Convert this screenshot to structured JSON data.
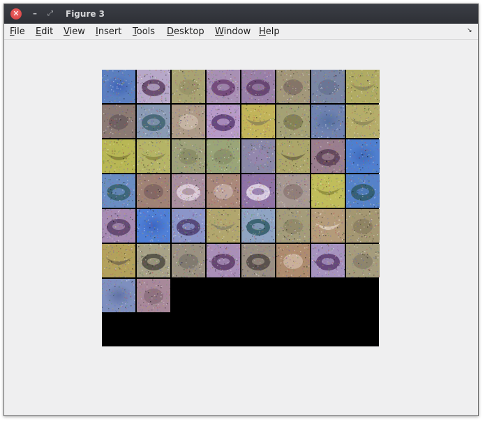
{
  "window": {
    "title": "Figure 3",
    "close_glyph": "✕",
    "minimize_glyph": "–",
    "restore_glyph": "⤢"
  },
  "menu": {
    "items": [
      {
        "label": "File",
        "mnemonic": "F"
      },
      {
        "label": "Edit",
        "mnemonic": "E"
      },
      {
        "label": "View",
        "mnemonic": "V"
      },
      {
        "label": "Insert",
        "mnemonic": "I"
      },
      {
        "label": "Tools",
        "mnemonic": "T"
      },
      {
        "label": "Desktop",
        "mnemonic": "D"
      },
      {
        "label": "Window",
        "mnemonic": "W"
      },
      {
        "label": "Help",
        "mnemonic": "H"
      }
    ],
    "dock_icon": "dock-arrow-icon",
    "dock_glyph": "↘"
  },
  "figure": {
    "grid_rows": 8,
    "grid_cols": 8,
    "filled_tiles": 50,
    "background_color": "#000000",
    "tiles": [
      {
        "bg": "#5b7fc0",
        "fg": "#3e63b8",
        "kind": "blob"
      },
      {
        "bg": "#b7a8c9",
        "fg": "#5d3e63",
        "kind": "ring"
      },
      {
        "bg": "#a8a373",
        "fg": "#8f8a63",
        "kind": "noise"
      },
      {
        "bg": "#a890b4",
        "fg": "#6c3f73",
        "kind": "ring"
      },
      {
        "bg": "#9a80a8",
        "fg": "#5f3c6a",
        "kind": "ring"
      },
      {
        "bg": "#a2977a",
        "fg": "#6b5a5a",
        "kind": "noise"
      },
      {
        "bg": "#7a86a4",
        "fg": "#5d6a8a",
        "kind": "noise"
      },
      {
        "bg": "#b0ab63",
        "fg": "#8c8a58",
        "kind": "smile"
      },
      {
        "bg": "#8b7a74",
        "fg": "#5a4b52",
        "kind": "noise"
      },
      {
        "bg": "#8a9ab5",
        "fg": "#3d6170",
        "kind": "ring"
      },
      {
        "bg": "#ae9b88",
        "fg": "#d8c9b9",
        "kind": "noise"
      },
      {
        "bg": "#b79ac8",
        "fg": "#5b3b73",
        "kind": "ring"
      },
      {
        "bg": "#c2b45a",
        "fg": "#8b8255",
        "kind": "smile"
      },
      {
        "bg": "#a4a175",
        "fg": "#6b6a3d",
        "kind": "noise"
      },
      {
        "bg": "#6f82b0",
        "fg": "#5470a2",
        "kind": "blob"
      },
      {
        "bg": "#b5ad6a",
        "fg": "#8e8659",
        "kind": "smile"
      },
      {
        "bg": "#b8b755",
        "fg": "#817e36",
        "kind": "smile"
      },
      {
        "bg": "#b5b466",
        "fg": "#8a8840",
        "kind": "smile"
      },
      {
        "bg": "#9ea07a",
        "fg": "#7c7f59",
        "kind": "noise"
      },
      {
        "bg": "#9aa578",
        "fg": "#7f8562",
        "kind": "noise"
      },
      {
        "bg": "#8a88a8",
        "fg": "#9a86b0",
        "kind": "noise"
      },
      {
        "bg": "#aca66a",
        "fg": "#6e6740",
        "kind": "smile"
      },
      {
        "bg": "#9a7e8e",
        "fg": "#5a3e55",
        "kind": "ring"
      },
      {
        "bg": "#4f7fcf",
        "fg": "#3e6bbd",
        "kind": "blob"
      },
      {
        "bg": "#6a8dc3",
        "fg": "#35606c",
        "kind": "ring"
      },
      {
        "bg": "#9f8276",
        "fg": "#6b5356",
        "kind": "noise"
      },
      {
        "bg": "#a88f9f",
        "fg": "#e2d4df",
        "kind": "ring"
      },
      {
        "bg": "#a9887a",
        "fg": "#d6c3c0",
        "kind": "noise"
      },
      {
        "bg": "#8f73a6",
        "fg": "#e5dcea",
        "kind": "ring"
      },
      {
        "bg": "#a79893",
        "fg": "#7d6a66",
        "kind": "noise"
      },
      {
        "bg": "#c0bd5b",
        "fg": "#8a8838",
        "kind": "smile"
      },
      {
        "bg": "#5582c9",
        "fg": "#2f5a68",
        "kind": "ring"
      },
      {
        "bg": "#a68bb3",
        "fg": "#5a3f68",
        "kind": "ring"
      },
      {
        "bg": "#4f7fd6",
        "fg": "#3b66c4",
        "kind": "blob"
      },
      {
        "bg": "#8b95c9",
        "fg": "#4b3c6e",
        "kind": "ring"
      },
      {
        "bg": "#b1a66e",
        "fg": "#8a8466",
        "kind": "smile"
      },
      {
        "bg": "#8fa4c3",
        "fg": "#2f5a66",
        "kind": "ring"
      },
      {
        "bg": "#a49c7a",
        "fg": "#857d5e",
        "kind": "noise"
      },
      {
        "bg": "#b49b7a",
        "fg": "#e0d1bd",
        "kind": "smile"
      },
      {
        "bg": "#a49772",
        "fg": "#7e7358",
        "kind": "noise"
      },
      {
        "bg": "#b3a15c",
        "fg": "#75684a",
        "kind": "smile"
      },
      {
        "bg": "#a7a287",
        "fg": "#4c4a40",
        "kind": "ring"
      },
      {
        "bg": "#9a9182",
        "fg": "#6d6760",
        "kind": "noise"
      },
      {
        "bg": "#a98fb8",
        "fg": "#5c3a66",
        "kind": "ring"
      },
      {
        "bg": "#9a8f83",
        "fg": "#4f4644",
        "kind": "ring"
      },
      {
        "bg": "#ae8c6f",
        "fg": "#e1cdbf",
        "kind": "noise"
      },
      {
        "bg": "#a693bf",
        "fg": "#5a3a6e",
        "kind": "ring"
      },
      {
        "bg": "#a59c7d",
        "fg": "#7c7360",
        "kind": "noise"
      },
      {
        "bg": "#7e8fbf",
        "fg": "#6172a6",
        "kind": "blob"
      },
      {
        "bg": "#a8899a",
        "fg": "#7a5f6e",
        "kind": "noise"
      }
    ]
  }
}
